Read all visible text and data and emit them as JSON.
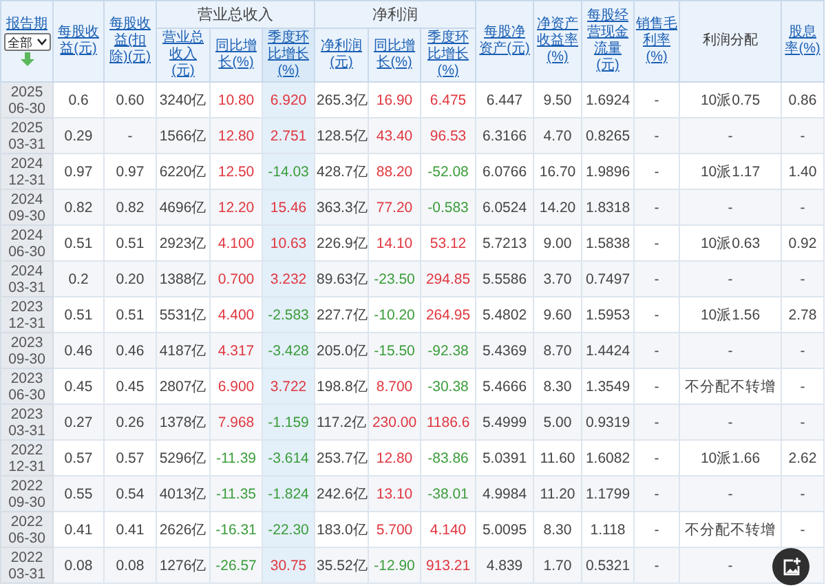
{
  "header": {
    "period_label": "报告期",
    "filter": "全部",
    "columns": [
      {
        "label": "每股收益(元)",
        "link": true
      },
      {
        "label": "每股收益(扣除)(元)",
        "link": true
      },
      {
        "label": "营业总收入",
        "link": false,
        "children": [
          {
            "label": "营业总收入(元)",
            "link": true
          },
          {
            "label": "同比增长(%)",
            "link": true
          },
          {
            "label": "季度环比增长(%)",
            "link": true,
            "highlighted": true
          }
        ]
      },
      {
        "label": "净利润",
        "link": false,
        "children": [
          {
            "label": "净利润(元)",
            "link": true
          },
          {
            "label": "同比增长(%)",
            "link": true
          },
          {
            "label": "季度环比增长(%)",
            "link": true,
            "highlighted": false
          }
        ]
      },
      {
        "label": "每股净资产(元)",
        "link": true
      },
      {
        "label": "净资产收益率(%)",
        "link": true
      },
      {
        "label": "每股经营现金流量(元)",
        "link": true
      },
      {
        "label": "销售毛利率(%)",
        "link": true
      },
      {
        "label": "利润分配",
        "link": false
      },
      {
        "label": "股息率(%)",
        "link": true
      }
    ]
  },
  "rows": [
    {
      "year": "2025",
      "date": "06-30",
      "cells": [
        "0.6",
        "0.60",
        "3240亿",
        {
          "text": "10.80",
          "rising": true
        },
        {
          "text": "6.920",
          "rising": true
        },
        "265.3亿",
        {
          "text": "16.90",
          "rising": true
        },
        {
          "text": "6.475",
          "rising": true
        },
        "6.447",
        "9.50",
        "1.6924",
        "-",
        "10派0.75",
        "0.86"
      ]
    },
    {
      "year": "2025",
      "date": "03-31",
      "cells": [
        "0.29",
        "-",
        "1566亿",
        {
          "text": "12.80",
          "rising": true
        },
        {
          "text": "2.751",
          "rising": true
        },
        "128.5亿",
        {
          "text": "43.40",
          "rising": true
        },
        {
          "text": "96.53",
          "rising": true
        },
        "6.3166",
        "4.70",
        "0.8265",
        "-",
        "-",
        "-"
      ]
    },
    {
      "year": "2024",
      "date": "12-31",
      "cells": [
        "0.97",
        "0.97",
        "6220亿",
        {
          "text": "12.50",
          "rising": true
        },
        {
          "text": "-14.03",
          "rising": false
        },
        "428.7亿",
        {
          "text": "88.20",
          "rising": true
        },
        {
          "text": "-52.08",
          "rising": false
        },
        "6.0766",
        "16.70",
        "1.9896",
        "-",
        "10派1.17",
        "1.40"
      ]
    },
    {
      "year": "2024",
      "date": "09-30",
      "cells": [
        "0.82",
        "0.82",
        "4696亿",
        {
          "text": "12.20",
          "rising": true
        },
        {
          "text": "15.46",
          "rising": true
        },
        "363.3亿",
        {
          "text": "77.20",
          "rising": true
        },
        {
          "text": "-0.583",
          "rising": false
        },
        "6.0524",
        "14.20",
        "1.8318",
        "-",
        "-",
        "-"
      ]
    },
    {
      "year": "2024",
      "date": "06-30",
      "cells": [
        "0.51",
        "0.51",
        "2923亿",
        {
          "text": "4.100",
          "rising": true
        },
        {
          "text": "10.63",
          "rising": true
        },
        "226.9亿",
        {
          "text": "14.10",
          "rising": true
        },
        {
          "text": "53.12",
          "rising": true
        },
        "5.7213",
        "9.00",
        "1.5838",
        "-",
        "10派0.63",
        "0.92"
      ]
    },
    {
      "year": "2024",
      "date": "03-31",
      "cells": [
        "0.2",
        "0.20",
        "1388亿",
        {
          "text": "0.700",
          "rising": true
        },
        {
          "text": "3.232",
          "rising": true
        },
        "89.63亿",
        {
          "text": "-23.50",
          "rising": false
        },
        {
          "text": "294.85",
          "rising": true
        },
        "5.5586",
        "3.70",
        "0.7497",
        "-",
        "-",
        "-"
      ]
    },
    {
      "year": "2023",
      "date": "12-31",
      "cells": [
        "0.51",
        "0.51",
        "5531亿",
        {
          "text": "4.400",
          "rising": true
        },
        {
          "text": "-2.583",
          "rising": false
        },
        "227.7亿",
        {
          "text": "-10.20",
          "rising": false
        },
        {
          "text": "264.95",
          "rising": true
        },
        "5.4802",
        "9.60",
        "1.5953",
        "-",
        "10派1.56",
        "2.78"
      ]
    },
    {
      "year": "2023",
      "date": "09-30",
      "cells": [
        "0.46",
        "0.46",
        "4187亿",
        {
          "text": "4.317",
          "rising": true
        },
        {
          "text": "-3.428",
          "rising": false
        },
        "205.0亿",
        {
          "text": "-15.50",
          "rising": false
        },
        {
          "text": "-92.38",
          "rising": false
        },
        "5.4369",
        "8.70",
        "1.4424",
        "-",
        "-",
        "-"
      ]
    },
    {
      "year": "2023",
      "date": "06-30",
      "cells": [
        "0.45",
        "0.45",
        "2807亿",
        {
          "text": "6.900",
          "rising": true
        },
        {
          "text": "3.722",
          "rising": true
        },
        "198.8亿",
        {
          "text": "8.700",
          "rising": true
        },
        {
          "text": "-30.38",
          "rising": false
        },
        "5.4666",
        "8.30",
        "1.3549",
        "-",
        "不分配不转增",
        "-"
      ]
    },
    {
      "year": "2023",
      "date": "03-31",
      "cells": [
        "0.27",
        "0.26",
        "1378亿",
        {
          "text": "7.968",
          "rising": true
        },
        {
          "text": "-1.159",
          "rising": false
        },
        "117.2亿",
        {
          "text": "230.00",
          "rising": true
        },
        {
          "text": "1186.6",
          "rising": true
        },
        "5.4999",
        "5.00",
        "0.9319",
        "-",
        "-",
        "-"
      ]
    },
    {
      "year": "2022",
      "date": "12-31",
      "cells": [
        "0.57",
        "0.57",
        "5296亿",
        {
          "text": "-11.39",
          "rising": false
        },
        {
          "text": "-3.614",
          "rising": false
        },
        "253.7亿",
        {
          "text": "12.80",
          "rising": true
        },
        {
          "text": "-83.86",
          "rising": false
        },
        "5.0391",
        "11.60",
        "1.6082",
        "-",
        "10派1.66",
        "2.62"
      ]
    },
    {
      "year": "2022",
      "date": "09-30",
      "cells": [
        "0.55",
        "0.54",
        "4013亿",
        {
          "text": "-11.35",
          "rising": false
        },
        {
          "text": "-1.824",
          "rising": false
        },
        "242.6亿",
        {
          "text": "13.10",
          "rising": true
        },
        {
          "text": "-38.01",
          "rising": false
        },
        "4.9984",
        "11.20",
        "1.1799",
        "-",
        "-",
        "-"
      ]
    },
    {
      "year": "2022",
      "date": "06-30",
      "cells": [
        "0.41",
        "0.41",
        "2626亿",
        {
          "text": "-16.31",
          "rising": false
        },
        {
          "text": "-22.30",
          "rising": false
        },
        "183.0亿",
        {
          "text": "5.700",
          "rising": true
        },
        {
          "text": "4.140",
          "rising": true
        },
        "5.0095",
        "8.30",
        "1.118",
        "-",
        "不分配不转增",
        "-"
      ]
    },
    {
      "year": "2022",
      "date": "03-31",
      "cells": [
        "0.08",
        "0.08",
        "1276亿",
        {
          "text": "-26.57",
          "rising": false
        },
        {
          "text": "30.75",
          "rising": true
        },
        "35.52亿",
        {
          "text": "-12.90",
          "rising": false
        },
        {
          "text": "913.21",
          "rising": true
        },
        "4.839",
        "1.70",
        "0.5321",
        "-",
        "-"
      ]
    }
  ]
}
